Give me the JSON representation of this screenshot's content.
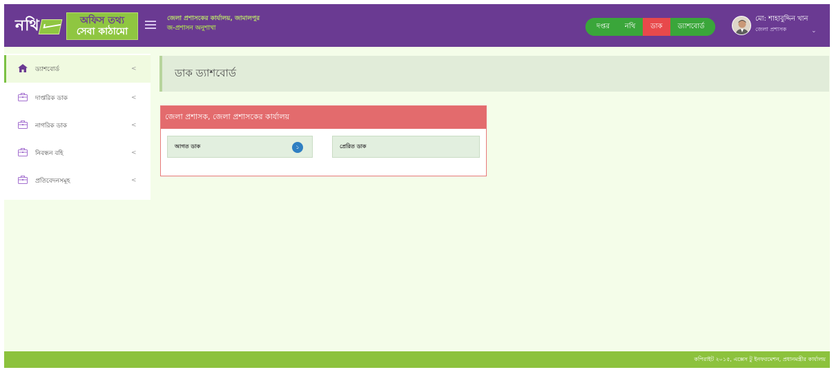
{
  "header": {
    "logo_text": "নথি",
    "logo_line1": "অফিস তথ্য",
    "logo_line2": "সেবা কাঠামো",
    "office_name": "জেলা প্রশাসকের কার্যালয়, জামালপুর",
    "office_unit": "জ-প্রশাসন অনুশাখা",
    "nav": [
      {
        "label": "দপ্তর",
        "active": false
      },
      {
        "label": "নথি",
        "active": false
      },
      {
        "label": "ডাক",
        "active": true
      },
      {
        "label": "ড্যাশবোর্ড",
        "active": false
      }
    ],
    "user_name": "মো: শাহাবুদ্দিন খান",
    "user_role": "জেলা প্রশাসক"
  },
  "sidebar": {
    "items": [
      {
        "label": "ড্যাশবোর্ড",
        "icon": "home-icon",
        "active": true
      },
      {
        "label": "দাপ্তরিক ডাক",
        "icon": "briefcase-icon",
        "active": false
      },
      {
        "label": "নাগরিক ডাক",
        "icon": "briefcase-icon",
        "active": false
      },
      {
        "label": "নিবন্ধন বহি",
        "icon": "briefcase-icon",
        "active": false
      },
      {
        "label": "প্রতিবেদনসমূহ",
        "icon": "briefcase-icon",
        "active": false
      }
    ]
  },
  "main": {
    "page_title": "ডাক ড্যাশবোর্ড",
    "panel_title": "জেলা প্রশাসক, জেলা প্রশাসকের কার্যালয়",
    "incoming_label": "আগত ডাক",
    "incoming_count": "১",
    "sent_label": "প্রেরিত ডাক"
  },
  "footer": {
    "copyright": "কপিরাইট ২০১৫, এক্সেস টু ইনফরমেশন, প্রধানমন্ত্রীর কার্যালয়"
  },
  "colors": {
    "header_bg": "#6a3a92",
    "accent_green": "#8cc23d",
    "nav_green": "#3aa63a",
    "nav_active_red": "#e8494b",
    "panel_red": "#e36b6d",
    "page_bg": "#f4fde9"
  }
}
